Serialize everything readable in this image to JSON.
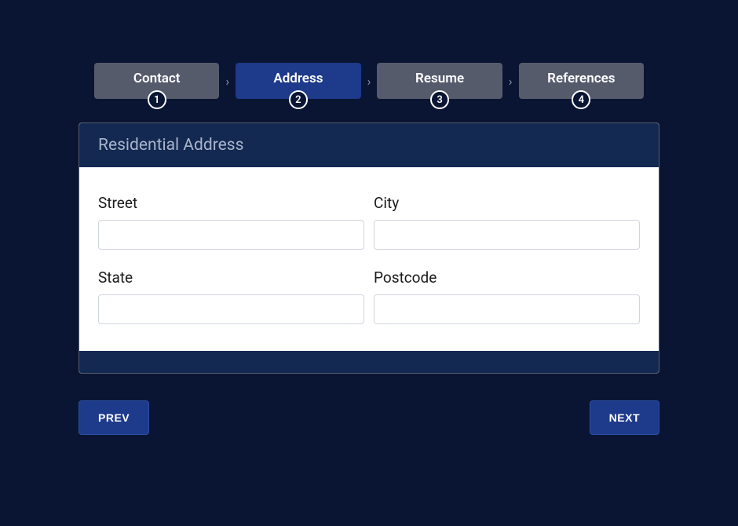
{
  "stepper": {
    "steps": [
      {
        "label": "Contact",
        "number": "1",
        "active": false
      },
      {
        "label": "Address",
        "number": "2",
        "active": true
      },
      {
        "label": "Resume",
        "number": "3",
        "active": false
      },
      {
        "label": "References",
        "number": "4",
        "active": false
      }
    ]
  },
  "panel": {
    "title": "Residential Address"
  },
  "fields": {
    "street": {
      "label": "Street",
      "value": ""
    },
    "city": {
      "label": "City",
      "value": ""
    },
    "state": {
      "label": "State",
      "value": ""
    },
    "postcode": {
      "label": "Postcode",
      "value": ""
    }
  },
  "buttons": {
    "prev": "PREV",
    "next": "NEXT"
  }
}
